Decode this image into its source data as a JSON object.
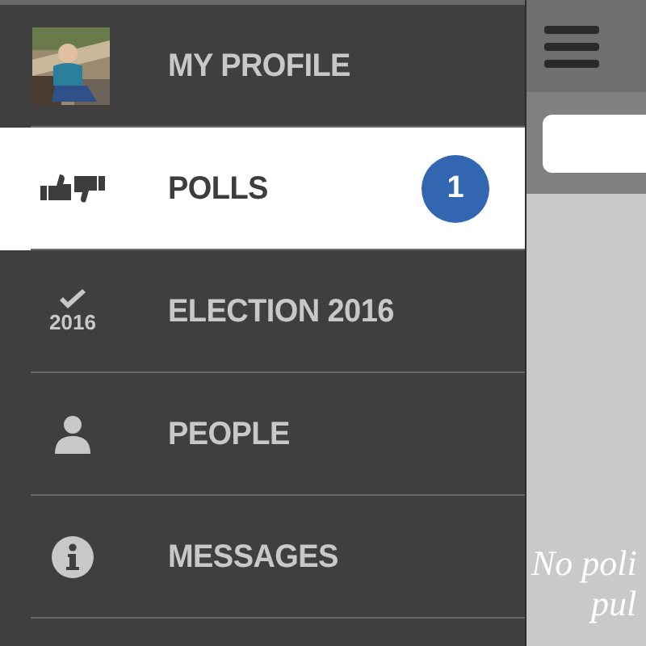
{
  "sidebar": {
    "items": [
      {
        "kind": "avatar",
        "label": "MY PROFILE",
        "selected": false
      },
      {
        "kind": "thumbs",
        "label": "POLLS",
        "selected": true,
        "badge": "1"
      },
      {
        "kind": "election",
        "label": "ELECTION 2016",
        "selected": false,
        "icon_text": "2016"
      },
      {
        "kind": "person",
        "label": "PEOPLE",
        "selected": false
      },
      {
        "kind": "info",
        "label": "MESSAGES",
        "selected": false
      }
    ]
  },
  "main": {
    "empty_message": [
      "No poli",
      "pul"
    ]
  }
}
